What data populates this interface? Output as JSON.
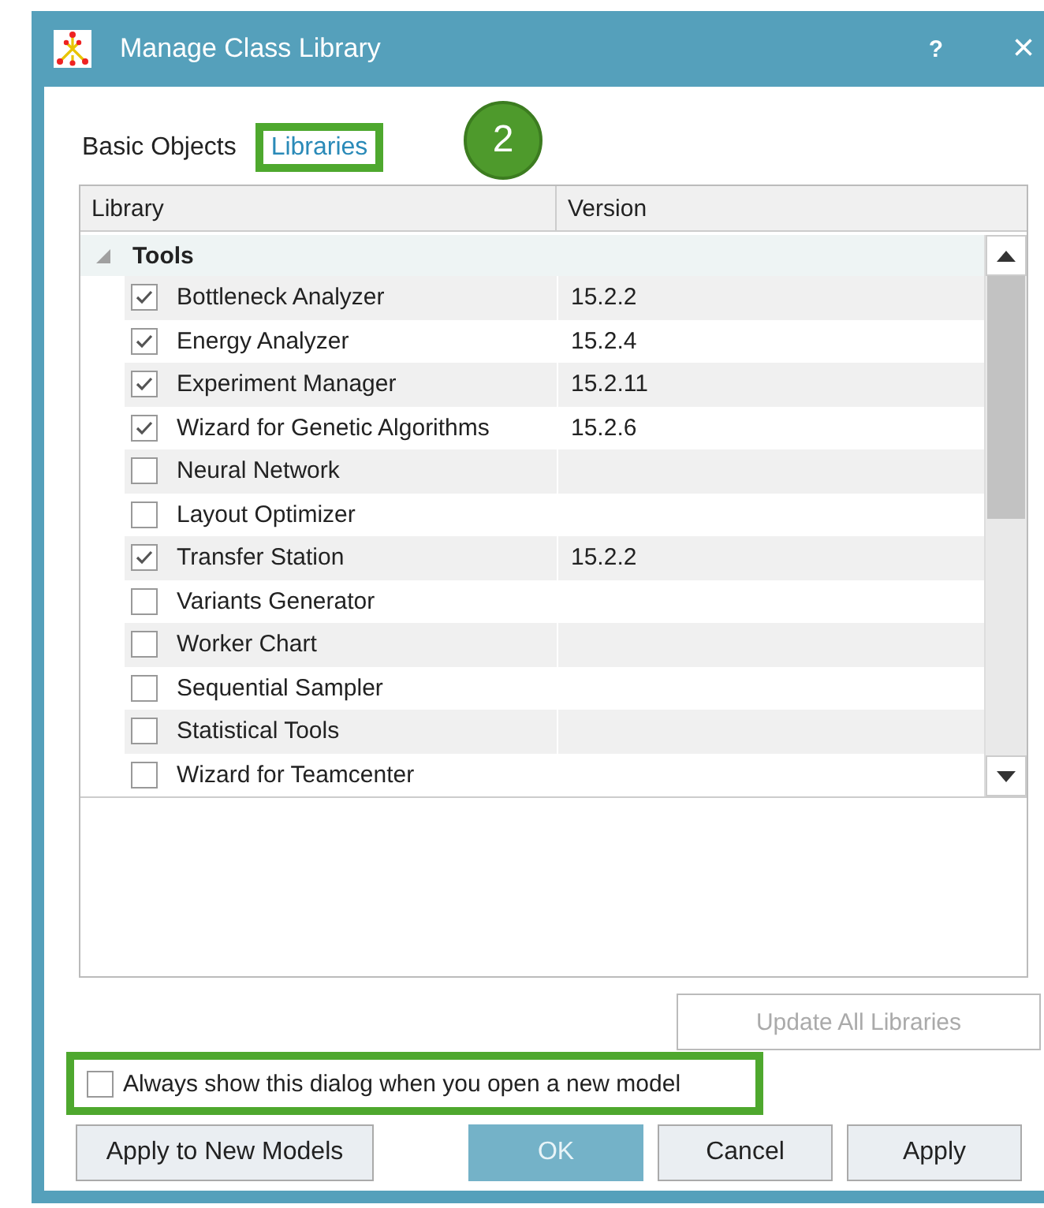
{
  "window": {
    "title": "Manage Class Library",
    "help": "?",
    "close": "×"
  },
  "tabs": [
    {
      "label": "Basic Objects",
      "selected": false,
      "highlighted": false
    },
    {
      "label": "Libraries",
      "selected": true,
      "highlighted": true
    }
  ],
  "callout": {
    "label": "2"
  },
  "table": {
    "columns": [
      "Library",
      "Version"
    ],
    "groups": [
      {
        "name": "Tools",
        "expanded": true,
        "rows": [
          {
            "name": "Bottleneck Analyzer",
            "version": "15.2.2",
            "checked": true
          },
          {
            "name": "Energy Analyzer",
            "version": "15.2.4",
            "checked": true
          },
          {
            "name": "Experiment Manager",
            "version": "15.2.11",
            "checked": true
          },
          {
            "name": "Wizard for Genetic Algorithms",
            "version": "15.2.6",
            "checked": true
          },
          {
            "name": "Neural Network",
            "version": "",
            "checked": false
          },
          {
            "name": "Layout Optimizer",
            "version": "",
            "checked": false
          },
          {
            "name": "Transfer Station",
            "version": "15.2.2",
            "checked": true
          },
          {
            "name": "Variants Generator",
            "version": "",
            "checked": false
          },
          {
            "name": "Worker Chart",
            "version": "",
            "checked": false
          },
          {
            "name": "Sequential Sampler",
            "version": "",
            "checked": false
          },
          {
            "name": "Statistical Tools",
            "version": "",
            "checked": false
          },
          {
            "name": "Wizard for Teamcenter",
            "version": "",
            "checked": false
          }
        ]
      }
    ]
  },
  "update_button": {
    "label": "Update All Libraries",
    "disabled": true
  },
  "always_show": {
    "label": "Always show this dialog when you open a new model",
    "checked": false,
    "highlighted": true
  },
  "buttons": [
    {
      "label": "Apply to New Models",
      "kind": "normal"
    },
    {
      "label": "OK",
      "kind": "primary"
    },
    {
      "label": "Cancel",
      "kind": "normal"
    },
    {
      "label": "Apply",
      "kind": "normal"
    }
  ]
}
